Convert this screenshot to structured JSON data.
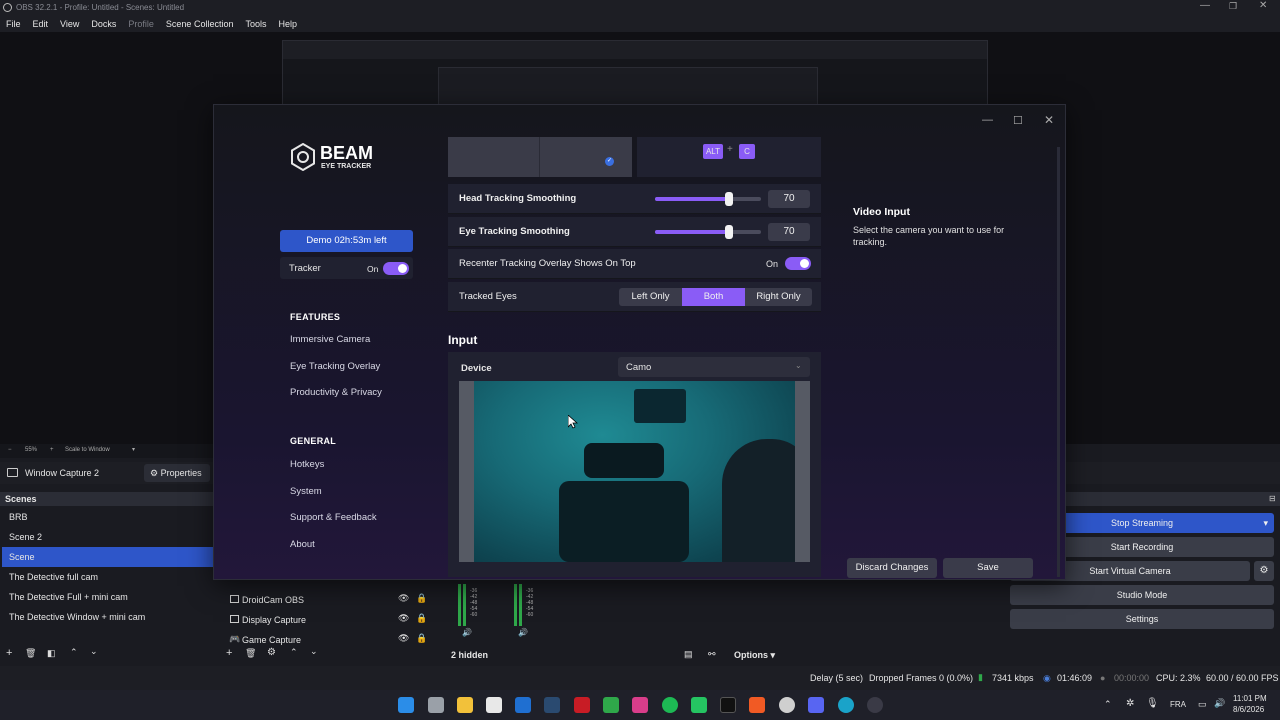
{
  "titlebar": {
    "title": "OBS 32.2.1 - Profile: Untitled - Scenes: Untitled"
  },
  "menubar": {
    "items": [
      "File",
      "Edit",
      "View",
      "Docks",
      "Profile",
      "Scene Collection",
      "Tools",
      "Help"
    ]
  },
  "preview": {
    "zoom": "55%",
    "scale_mode": "Scale to Window"
  },
  "source_bar": {
    "source_name": "Window Capture 2",
    "properties_label": "Properties"
  },
  "scenes": {
    "title": "Scenes",
    "items": [
      "BRB",
      "Scene 2",
      "Scene",
      "The Detective full cam",
      "The Detective Full + mini cam",
      "The Detective Window + mini cam"
    ],
    "active_index": 2
  },
  "sources": {
    "items": [
      "DroidCam OBS",
      "Display Capture",
      "Game Capture"
    ]
  },
  "mixer": {
    "hidden_label": "2 hidden",
    "options_label": "Options",
    "db_ticks": [
      "-36",
      "-42",
      "-48",
      "-54",
      "-60"
    ]
  },
  "controls": {
    "stop_streaming": "Stop Streaming",
    "start_recording": "Start Recording",
    "start_virtual_camera": "Start Virtual Camera",
    "studio_mode": "Studio Mode",
    "settings": "Settings",
    "accent": "#2e56c9"
  },
  "status": {
    "delay": "Delay (5 sec)",
    "dropped": "Dropped Frames 0 (0.0%)",
    "bitrate": "7341 kbps",
    "stream_time": "01:46:09",
    "rec_time": "00:00:00",
    "cpu": "CPU: 2.3%",
    "fps": "60.00 / 60.00 FPS"
  },
  "taskbar": {
    "lang": "FRA",
    "time": "11:01 PM",
    "date": "8/6/2026"
  },
  "beam": {
    "logo_title": "BEAM",
    "logo_subtitle": "EYE TRACKER",
    "demo_label": "Demo 02h:53m left",
    "tracker_label": "Tracker",
    "tracker_state": "On",
    "features_heading": "FEATURES",
    "features": [
      "Immersive Camera",
      "Eye Tracking Overlay",
      "Productivity & Privacy"
    ],
    "general_heading": "GENERAL",
    "general": [
      "Hotkeys",
      "System",
      "Support & Feedback",
      "About"
    ],
    "hotkey_keys": [
      "ALT",
      "+",
      "C"
    ],
    "head_smoothing_label": "Head Tracking Smoothing",
    "head_smoothing_value": "70",
    "eye_smoothing_label": "Eye Tracking Smoothing",
    "eye_smoothing_value": "70",
    "recenter_label": "Recenter Tracking Overlay Shows On Top",
    "recenter_state": "On",
    "tracked_eyes_label": "Tracked Eyes",
    "tracked_eyes_options": [
      "Left Only",
      "Both",
      "Right Only"
    ],
    "tracked_eyes_selected": "Both",
    "input_heading": "Input",
    "device_label": "Device",
    "device_value": "Camo",
    "info_title": "Video Input",
    "info_text": "Select the camera you want to use for tracking.",
    "discard_label": "Discard Changes",
    "save_label": "Save",
    "accent": "#8a5cf6"
  }
}
